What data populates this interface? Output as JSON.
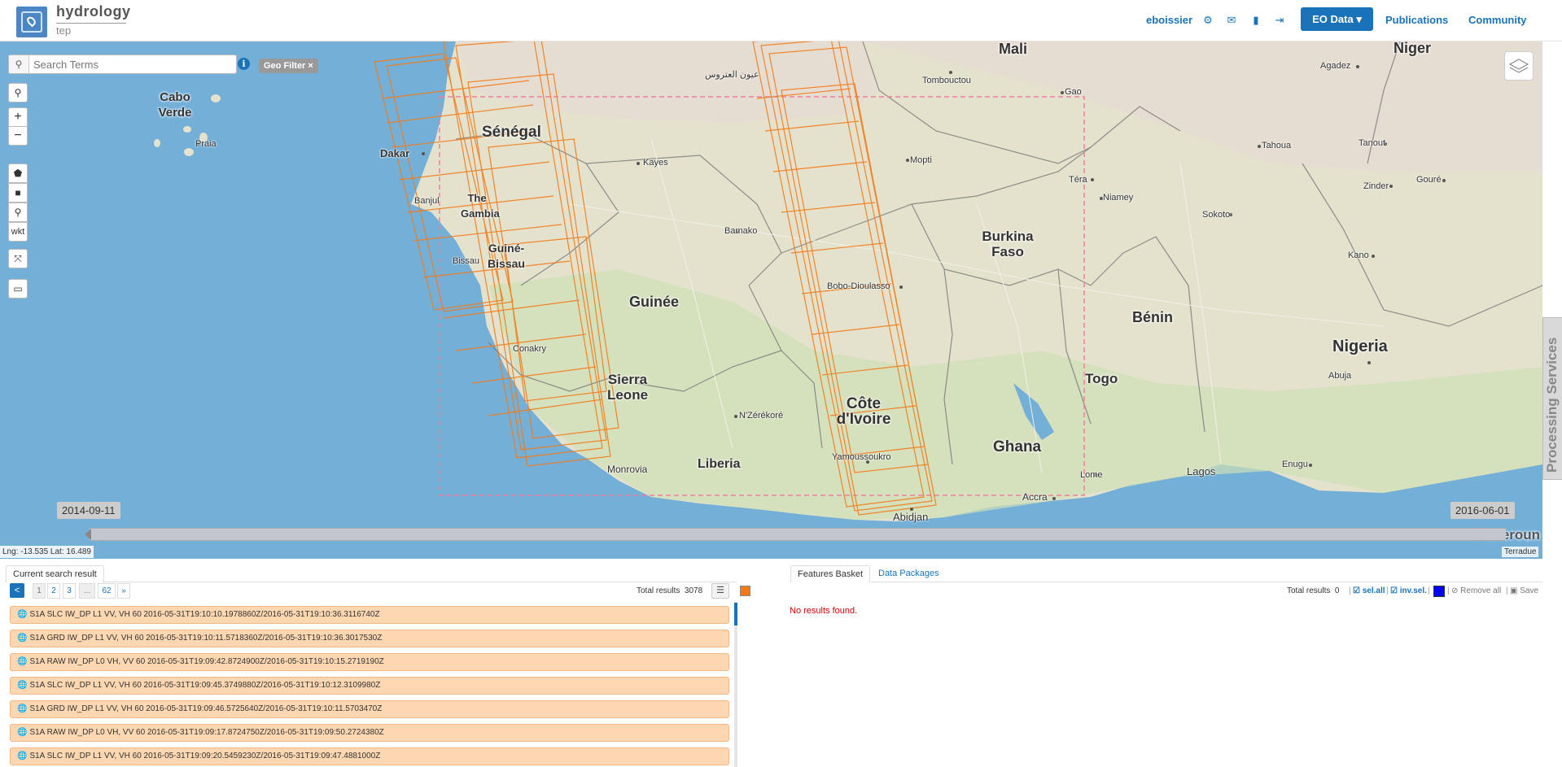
{
  "header": {
    "brand_title": "hydrology",
    "brand_sub": "tep",
    "username": "eboissier",
    "eo_data_label": "EO Data ▾",
    "publications_label": "Publications",
    "community_label": "Community",
    "icons": [
      "gear-icon",
      "envelope-icon",
      "book-icon",
      "sign-out-icon"
    ]
  },
  "map": {
    "search_placeholder": "Search Terms",
    "geo_filter_label": "Geo Filter ×",
    "tools": [
      "search",
      "zoom-in",
      "zoom-out",
      "draw-polygon",
      "draw-box",
      "draw-point",
      "wkt",
      "fullscreen",
      "measure"
    ],
    "wkt_label": "wkt",
    "processing_services_label": "Processing Services",
    "timeline_start": "2014-09-11",
    "timeline_end": "2016-06-01",
    "coords_text": "Lng: -13.535 Lat: 16.489",
    "attribution": "Terradue",
    "countries": [
      {
        "name": "Mali"
      },
      {
        "name": "Niger"
      },
      {
        "name": "Cabo Verde"
      },
      {
        "name": "Sénégal"
      },
      {
        "name": "The Gambia"
      },
      {
        "name": "Guiné-Bissau"
      },
      {
        "name": "Guinée"
      },
      {
        "name": "Burkina Faso"
      },
      {
        "name": "Bénin"
      },
      {
        "name": "Nigeria"
      },
      {
        "name": "Togo"
      },
      {
        "name": "Sierra Leone"
      },
      {
        "name": "Côte d'Ivoire"
      },
      {
        "name": "Ghana"
      },
      {
        "name": "Liberia"
      },
      {
        "name": "Cameroun"
      }
    ],
    "cities": [
      "عيون العتروس",
      "Tombouctou",
      "Gao",
      "Agadez",
      "Praia",
      "Dakar",
      "Kayes",
      "Mopti",
      "Tahoua",
      "Tanout",
      "Banjul",
      "Téra",
      "Niamey",
      "Zinder",
      "Gouré",
      "Sokoto",
      "Bamako",
      "Bissau",
      "Kano",
      "Bobo-Dioulasso",
      "Conakry",
      "Abuja",
      "N'Zérékoré",
      "Yamoussoukro",
      "Enugu",
      "Monrovia",
      "Lome",
      "Lagos",
      "Accra",
      "Abidjan"
    ]
  },
  "results": {
    "tab_label": "Current search result",
    "pages": [
      "1",
      "2",
      "3",
      "...",
      "62",
      "»"
    ],
    "total_label": "Total results",
    "total_value": "3078",
    "items": [
      "S1A SLC IW_DP L1 VV, VH 60 2016-05-31T19:10:10.1978860Z/2016-05-31T19:10:36.3116740Z",
      "S1A GRD IW_DP L1 VV, VH 60 2016-05-31T19:10:11.5718360Z/2016-05-31T19:10:36.3017530Z",
      "S1A RAW IW_DP L0 VH, VV 60 2016-05-31T19:09:42.8724900Z/2016-05-31T19:10:15.2719190Z",
      "S1A SLC IW_DP L1 VV, VH 60 2016-05-31T19:09:45.3749880Z/2016-05-31T19:10:12.3109980Z",
      "S1A GRD IW_DP L1 VV, VH 60 2016-05-31T19:09:46.5725640Z/2016-05-31T19:10:11.5703470Z",
      "S1A RAW IW_DP L0 VH, VV 60 2016-05-31T19:09:17.8724750Z/2016-05-31T19:09:50.2724380Z",
      "S1A SLC IW_DP L1 VV, VH 60 2016-05-31T19:09:20.5459230Z/2016-05-31T19:09:47.4881000Z"
    ],
    "row_color": "#fdd7b1",
    "footprint_color": "#f47a17"
  },
  "basket": {
    "tab_features": "Features Basket",
    "tab_packages": "Data Packages",
    "total_label": "Total results",
    "total_value": "0",
    "sel_all": "sel.all",
    "inv_sel": "inv.sel.",
    "remove_all": "Remove all",
    "save": "Save",
    "no_results": "No results found.",
    "color": "#0000ff"
  }
}
